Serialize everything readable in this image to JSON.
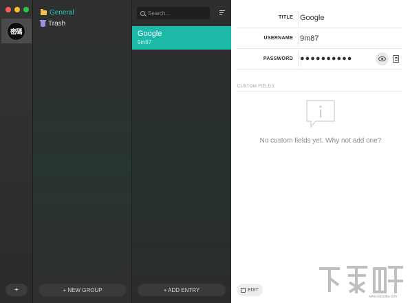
{
  "window": {
    "controls": [
      "close",
      "minimize",
      "maximize"
    ]
  },
  "archives": {
    "items": [
      {
        "logo_text": "密碼"
      }
    ],
    "add_label": "+"
  },
  "groups": {
    "items": [
      {
        "label": "General",
        "icon": "folder-icon",
        "color": "#2cc4b7"
      },
      {
        "label": "Trash",
        "icon": "trash-icon"
      }
    ],
    "new_group_label": "+ NEW GROUP"
  },
  "entries": {
    "search_placeholder": "Search...",
    "items": [
      {
        "title": "Google",
        "subtitle": "9m87"
      }
    ],
    "add_entry_label": "+ ADD ENTRY",
    "selected_color": "#1cb8a8"
  },
  "detail": {
    "fields": {
      "title_label": "TITLE",
      "title_value": "Google",
      "username_label": "USERNAME",
      "username_value": "9m87",
      "password_label": "PASSWORD",
      "password_value": "●●●●●●●●●●"
    },
    "custom_fields_label": "CUSTOM FIELDS:",
    "empty_message": "No custom fields yet. Why not add one?",
    "edit_label": "EDIT"
  },
  "watermark": {
    "url": "www.xiazaiba.com"
  }
}
